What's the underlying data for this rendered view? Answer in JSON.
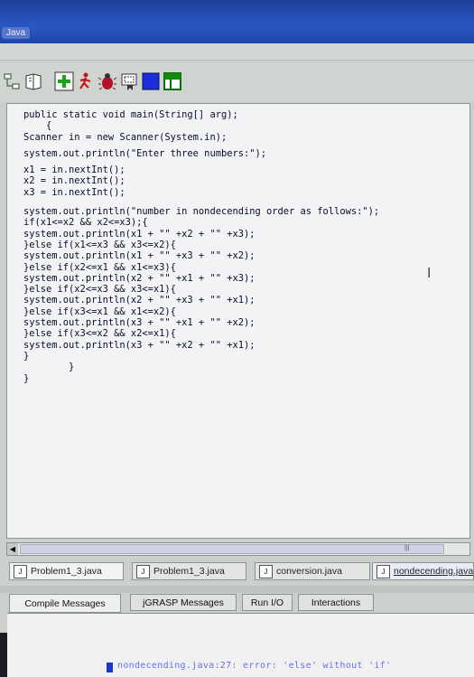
{
  "window": {
    "title": "Java"
  },
  "toolbar": {
    "icons": [
      "uml-icon",
      "browse-icon",
      "add-icon",
      "run-icon",
      "debug-icon",
      "bookmark-icon",
      "blue-square-icon",
      "green-split-icon"
    ]
  },
  "editor": {
    "lines": [
      "public static void main(String[] arg);",
      "    {",
      "Scanner in = new Scanner(System.in);",
      "",
      "system.out.println(\"Enter three numbers:\");",
      "",
      "x1 = in.nextInt();",
      "x2 = in.nextInt();",
      "x3 = in.nextInt();",
      "",
      "system.out.println(\"number in nondecending order as follows:\");",
      "if(x1<=x2 && x2<=x3);{",
      "system.out.println(x1 + \"\" +x2 + \"\" +x3);",
      "}else if(x1<=x3 && x3<=x2){",
      "system.out.println(x1 + \"\" +x3 + \"\" +x2);",
      "}else if(x2<=x1 && x1<=x3){",
      "system.out.println(x2 + \"\" +x1 + \"\" +x3);",
      "}else if(x2<=x3 && x3<=x1){",
      "system.out.println(x2 + \"\" +x3 + \"\" +x1);",
      "}else if(x3<=x1 && x1<=x2){",
      "system.out.println(x3 + \"\" +x1 + \"\" +x2);",
      "}else if(x3<=x2 && x2<=x1){",
      "system.out.println(x3 + \"\" +x2 + \"\" +x1);",
      "}",
      "        }",
      "}"
    ]
  },
  "file_tabs": [
    "Problem1_3.java",
    "Problem1_3.java",
    "conversion.java",
    "nondecending.java"
  ],
  "message_tabs": [
    "Compile Messages",
    "jGRASP Messages",
    "Run I/O",
    "Interactions"
  ],
  "messages": {
    "line": "nondecending.java:27: error: 'else' without 'if'"
  }
}
